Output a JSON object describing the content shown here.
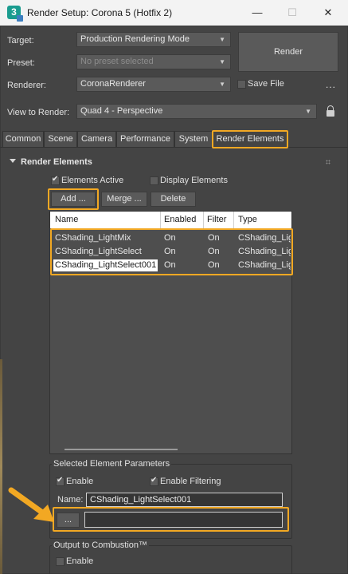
{
  "window": {
    "icon_text": "3",
    "title": "Render Setup: Corona 5 (Hotfix 2)",
    "minimize": "—",
    "maximize": "☐",
    "close": "✕"
  },
  "top": {
    "target_label": "Target:",
    "target_value": "Production Rendering Mode",
    "preset_label": "Preset:",
    "preset_value": "No preset selected",
    "renderer_label": "Renderer:",
    "renderer_value": "CoronaRenderer",
    "view_label": "View to Render:",
    "view_value": "Quad 4 - Perspective",
    "render_button": "Render",
    "save_file_label": "Save File",
    "save_file_checked": false,
    "more": "..."
  },
  "tabs": [
    {
      "label": "Common",
      "active": false
    },
    {
      "label": "Scene",
      "active": false
    },
    {
      "label": "Camera",
      "active": false
    },
    {
      "label": "Performance",
      "active": false
    },
    {
      "label": "System",
      "active": false
    },
    {
      "label": "Render Elements",
      "active": true
    }
  ],
  "rollout": {
    "title": "Render Elements",
    "elements_active_label": "Elements Active",
    "elements_active_checked": true,
    "display_elements_label": "Display Elements",
    "display_elements_checked": false,
    "add_button": "Add ...",
    "merge_button": "Merge ...",
    "delete_button": "Delete"
  },
  "list": {
    "columns": [
      "Name",
      "Enabled",
      "Filter",
      "Type"
    ],
    "rows": [
      {
        "name": "CShading_LightMix",
        "enabled": "On",
        "filter": "On",
        "type": "CShading_Lig...",
        "selected": false
      },
      {
        "name": "CShading_LightSelect",
        "enabled": "On",
        "filter": "On",
        "type": "CShading_Lig...",
        "selected": false
      },
      {
        "name": "CShading_LightSelect001",
        "enabled": "On",
        "filter": "On",
        "type": "CShading_Lig...",
        "selected": true
      }
    ]
  },
  "params": {
    "group_title": "Selected Element Parameters",
    "enable_label": "Enable",
    "enable_checked": true,
    "filtering_label": "Enable Filtering",
    "filtering_checked": true,
    "name_label": "Name:",
    "name_value": "CShading_LightSelect001",
    "browse_button": "...",
    "path_value": ""
  },
  "combustion": {
    "group_title": "Output to Combustion™",
    "enable_label": "Enable",
    "enable_checked": false
  },
  "colors": {
    "highlight": "#f2a823",
    "panel_bg": "#444444",
    "header_bg": "#ffffff"
  }
}
